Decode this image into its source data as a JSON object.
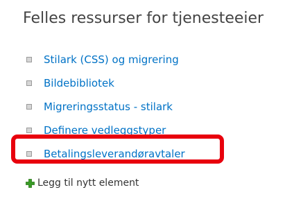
{
  "section": {
    "title": "Felles ressurser for tjenesteeier"
  },
  "links": [
    {
      "label": "Stilark (CSS) og migrering"
    },
    {
      "label": "Bildebibliotek"
    },
    {
      "label": "Migreringsstatus - stilark"
    },
    {
      "label": "Definere vedleggstyper"
    },
    {
      "label": "Betalingsleverandøravtaler",
      "highlighted": true
    }
  ],
  "add_item": {
    "label": "Legg til nytt element",
    "icon": "plus-icon"
  },
  "colors": {
    "link": "#0072c6",
    "heading": "#444444",
    "highlight": "#e8000d",
    "plus": "#3a9b27"
  }
}
